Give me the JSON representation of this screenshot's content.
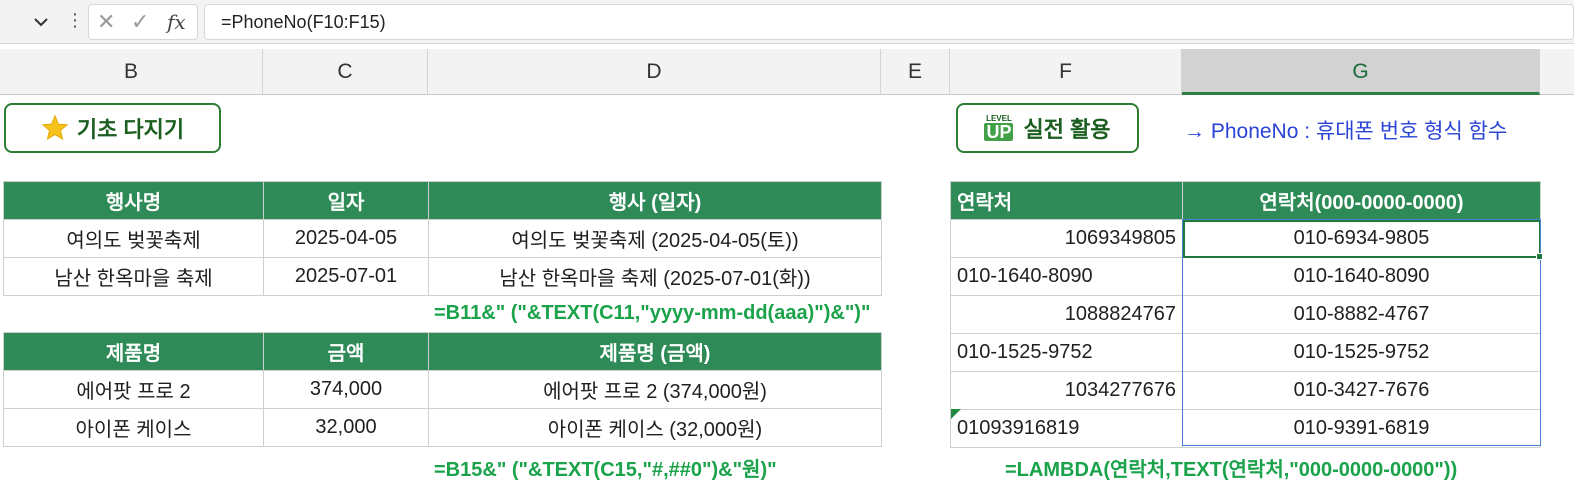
{
  "formula_bar": {
    "formula": "=PhoneNo(F10:F15)",
    "cancel_glyph": "✕",
    "enter_glyph": "✓",
    "fx_label": "fx"
  },
  "columns": [
    "B",
    "C",
    "D",
    "E",
    "F",
    "G"
  ],
  "selected_column": "G",
  "badges": {
    "basics": "기초 다지기",
    "level": "LEVEL",
    "up": "UP",
    "practical": "실전 활용"
  },
  "note": "→ PhoneNo : 휴대폰 번호 형식 함수",
  "event_table": {
    "headers": [
      "행사명",
      "일자",
      "행사 (일자)"
    ],
    "rows": [
      [
        "여의도 벚꽃축제",
        "2025-04-05",
        "여의도 벚꽃축제 (2025-04-05(토))"
      ],
      [
        "남산 한옥마을 축제",
        "2025-07-01",
        "남산 한옥마을 축제 (2025-07-01(화))"
      ]
    ],
    "formula": "=B11&\" (\"&TEXT(C11,\"yyyy-mm-dd(aaa)\")&\")\""
  },
  "product_table": {
    "headers": [
      "제품명",
      "금액",
      "제품명 (금액)"
    ],
    "rows": [
      [
        "에어팟 프로 2",
        "374,000",
        "에어팟 프로 2 (374,000원)"
      ],
      [
        "아이폰 케이스",
        "32,000",
        "아이폰 케이스 (32,000원)"
      ]
    ],
    "formula": "=B15&\" (\"&TEXT(C15,\"#,##0\")&\"원)\""
  },
  "phone_table": {
    "headers": [
      "연락처",
      "연락처(000-0000-0000)"
    ],
    "rows": [
      [
        "1069349805",
        "010-6934-9805"
      ],
      [
        "010-1640-8090",
        "010-1640-8090"
      ],
      [
        "1088824767",
        "010-8882-4767"
      ],
      [
        "010-1525-9752",
        "010-1525-9752"
      ],
      [
        "1034277676",
        "010-3427-7676"
      ],
      [
        "01093916819",
        "010-9391-6819"
      ]
    ],
    "formula": "=LAMBDA(연락처,TEXT(연락처,\"000-0000-0000\"))"
  },
  "colors": {
    "header_green": "#2e8b57",
    "formula_green": "#1aa34a",
    "note_blue": "#2a44d6",
    "badge_border": "#2e7d32"
  }
}
